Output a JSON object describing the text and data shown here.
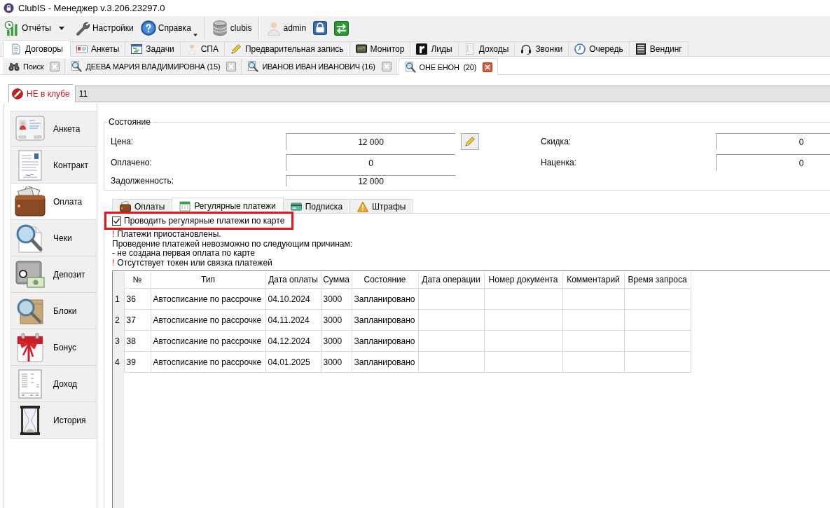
{
  "window": {
    "title": "ClubIS - Менеджер v.3.206.23297.0"
  },
  "toolbar": [
    [
      {
        "kind": "split",
        "label": "Отчёты"
      },
      {
        "kind": "plain",
        "label": "Настройки"
      },
      {
        "kind": "menu",
        "label": "Справка"
      }
    ],
    [
      {
        "kind": "plain",
        "label": "clubis"
      }
    ],
    [
      {
        "kind": "plain",
        "label": "admin"
      },
      {
        "kind": "icon"
      },
      {
        "kind": "icon"
      }
    ]
  ],
  "main_tabs": [
    {
      "label": "Договоры",
      "selected": true
    },
    {
      "label": "Анкеты",
      "selected": false
    },
    {
      "label": "Задачи",
      "selected": false
    },
    {
      "label": "СПА",
      "selected": false
    },
    {
      "label": "Предварительная запись",
      "selected": false
    },
    {
      "label": "Монитор",
      "selected": false
    },
    {
      "label": "Лиды",
      "selected": false
    },
    {
      "label": "Доходы",
      "selected": false
    },
    {
      "label": "Звонки",
      "selected": false
    },
    {
      "label": "Очередь",
      "selected": false
    },
    {
      "label": "Вендинг",
      "selected": false
    }
  ],
  "client_tabs": [
    {
      "label": "Поиск",
      "selected": false
    },
    {
      "label": "ДЕЕВА МАРИЯ ВЛАДИМИРОВНА (15)",
      "selected": false
    },
    {
      "label": "ИВАНОВ ИВАН ИВАНОВИЧ (16)",
      "selected": false
    },
    {
      "label": "ОНЕ ЕНОН  (20)",
      "selected": true
    }
  ],
  "status": {
    "label": "НЕ в клубе",
    "value": "11"
  },
  "sidebar": {
    "items": [
      {
        "label": "Анкета",
        "selected": false
      },
      {
        "label": "Контракт",
        "selected": false
      },
      {
        "label": "Оплата",
        "selected": true
      },
      {
        "label": "Чеки",
        "selected": false
      },
      {
        "label": "Депозит",
        "selected": false
      },
      {
        "label": "Блоки",
        "selected": false
      },
      {
        "label": "Бонус",
        "selected": false
      },
      {
        "label": "Доход",
        "selected": false
      },
      {
        "label": "История",
        "selected": false
      }
    ]
  },
  "state_group": {
    "title": "Состояние",
    "left_fields": [
      {
        "label": "Цена:",
        "value": "12 000",
        "editable": true
      },
      {
        "label": "Оплачено:",
        "value": "0",
        "editable": false
      },
      {
        "label": "Задолженность:",
        "value": "12 000",
        "editable": false
      }
    ],
    "right_fields": [
      {
        "label": "Скидка:",
        "value": "0"
      },
      {
        "label": "Наценка:",
        "value": "0"
      }
    ]
  },
  "sub_tabs": [
    {
      "label": "Оплаты",
      "selected": false
    },
    {
      "label": "Регулярные платежи",
      "selected": true
    },
    {
      "label": "Подписка",
      "selected": false
    },
    {
      "label": "Штрафы",
      "selected": false
    }
  ],
  "autopay_checkbox": {
    "label": "Проводить регулярные платежи по карте",
    "checked": true,
    "highlighted": true
  },
  "messages": [
    {
      "mark": "!",
      "text": "Платежи приостановлены."
    },
    {
      "text": "Проведение платежей невозможно по следующим причинам:"
    },
    {
      "text": "- не создана первая оплата по карте"
    },
    {
      "mark": "!",
      "text": "Отсутствует токен или связка платежей"
    }
  ],
  "table": {
    "columns": [
      "№",
      "Тип",
      "Дата оплаты",
      "Сумма",
      "Состояние",
      "Дата операции",
      "Номер документа",
      "Комментарий",
      "Время запроса"
    ],
    "rows": [
      {
        "number": "1",
        "cells": [
          "36",
          "Автосписание по рассрочке",
          "04.10.2024",
          "3000",
          "Запланировано"
        ]
      },
      {
        "number": "2",
        "cells": [
          "37",
          "Автосписание по рассрочке",
          "04.11.2024",
          "3000",
          "Запланировано"
        ]
      },
      {
        "number": "3",
        "cells": [
          "38",
          "Автосписание по рассрочке",
          "04.12.2024",
          "3000",
          "Запланировано"
        ]
      },
      {
        "number": "4",
        "cells": [
          "39",
          "Автосписание по рассрочке",
          "04.01.2025",
          "3000",
          "Запланировано"
        ]
      }
    ]
  }
}
